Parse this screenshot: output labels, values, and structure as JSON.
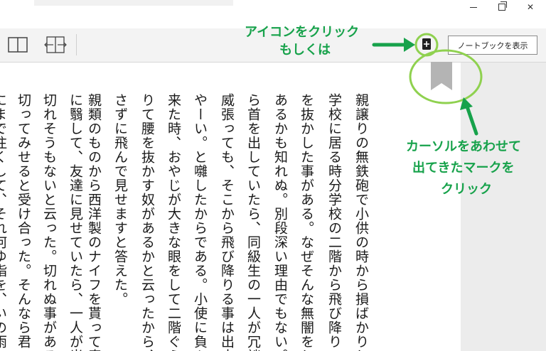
{
  "window": {
    "minimize_icon": "minimize-icon",
    "maximize_icon": "restore-icon",
    "close_icon": "close-icon",
    "close_glyph": "✕"
  },
  "toolbar": {
    "two_page_icon": "two-page-view-icon",
    "fit_width_icon": "fit-width-icon",
    "bookmark_icon": "bookmark-add-icon",
    "notebook_label": "ノートブックを表示"
  },
  "content": {
    "columns": [
      "親譲りの無鉄砲で小供の時から損ばかりし",
      "学校に居る時分学校の二階から飛び降りて一",
      "を抜かした事がある。なぜそんな無闇をした",
      "あるかも知れぬ。別段深い理由でもない。新",
      "ら首を出していたら、同級生の一人が冗談",
      "威張っても、そこから飛び降りる事は出来",
      "やーい。と囃したからである。小使に負ぶさ",
      "来た時、おやじが大きな眼をして二階ぐらい",
      "りて腰を抜かす奴があるかと云ったから、こ",
      "さずに飛んで見せますと答えた。",
      "親類のものから西洋製のナイフを貰って奇",
      "に翳して、友達に見せていたら、一人が光る",
      "切れそうもないと云った。切れぬ事がある",
      "切ってみせると受け合った。そんなら君の指",
      "にまで注くして、それ何ゆ指を、いの雨"
    ]
  },
  "annotations": {
    "click_icon_line1": "アイコンをクリック",
    "click_icon_line2": "もしくは",
    "hover_line1": "カーソルをあわせて",
    "hover_line2": "出てきたマークを",
    "hover_line3": "クリック",
    "accent_color": "#17a24b"
  }
}
